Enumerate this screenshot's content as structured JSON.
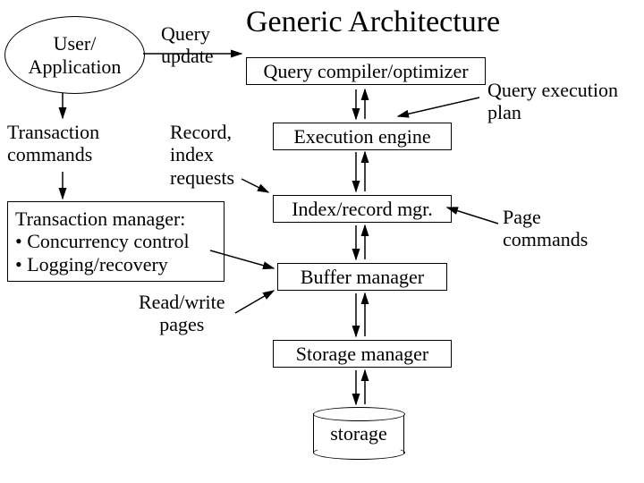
{
  "title": "Generic Architecture",
  "nodes": {
    "user_app": "User/\nApplication",
    "query_update": "Query\nupdate",
    "query_compiler": "Query compiler/optimizer",
    "transaction_commands": "Transaction\ncommands",
    "record_index_requests": "Record,\nindex\nrequests",
    "execution_engine": "Execution engine",
    "query_execution_plan": "Query execution\nplan",
    "transaction_manager_header": "Transaction manager:",
    "transaction_manager_b1": "• Concurrency control",
    "transaction_manager_b2": "• Logging/recovery",
    "index_record_mgr": "Index/record mgr.",
    "page_commands": "Page\ncommands",
    "buffer_manager": "Buffer manager",
    "read_write_pages": "Read/write\npages",
    "storage_manager": "Storage manager",
    "storage": "storage"
  }
}
